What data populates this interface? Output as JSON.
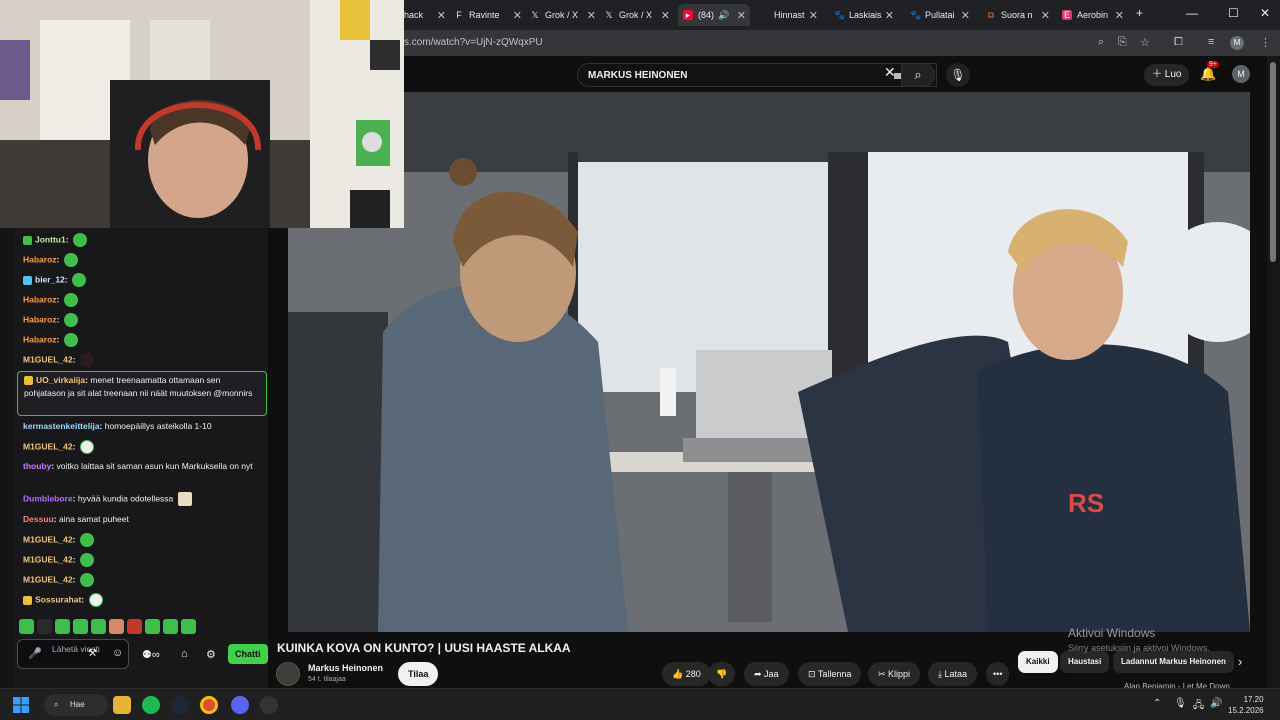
{
  "browser": {
    "tabs": [
      {
        "label": "hack",
        "favicon": "generic-icon"
      },
      {
        "label": "Ravinte",
        "favicon": "f-icon"
      },
      {
        "label": "Grok / X",
        "favicon": "x-icon"
      },
      {
        "label": "Grok / X",
        "favicon": "x-icon"
      },
      {
        "label": "(84)",
        "favicon": "youtube-icon",
        "active": true
      },
      {
        "label": "Hinnast",
        "favicon": "blank-icon"
      },
      {
        "label": "Laskiais",
        "favicon": "paw-icon"
      },
      {
        "label": "Pullatai",
        "favicon": "paw-icon"
      },
      {
        "label": "Suora n",
        "favicon": "link-icon"
      },
      {
        "label": "Aerobin",
        "favicon": "e-icon"
      }
    ],
    "url": "s.com/watch?v=UjN-zQWqxPU",
    "profile_initial": "M"
  },
  "youtube": {
    "search_query": "MARKUS HEINONEN",
    "create_label": "Luo",
    "notifications": "9+",
    "avatar_initial": "M",
    "video_title": "KUINKA KOVA ON KUNTO? | UUSI HAASTE ALKAA",
    "channel_name": "Markus Heinonen",
    "channel_subs": "54 t. tilaajaa",
    "subscribe_label": "Tilaa",
    "like_count": "280",
    "share_label": "Jaa",
    "save_label": "Tallenna",
    "clip_label": "Klippi",
    "download_label": "Lataa",
    "chips": [
      "Kaikki",
      "Haustasi",
      "Ladannut Markus Heinonen"
    ],
    "related_snippet": "Alan Benjamin - Let Me Down",
    "windows_activation_title": "Aktivoi Windows",
    "windows_activation_text": "Siirry asetuksiin ja aktivoi Windows."
  },
  "chat": {
    "messages": [
      {
        "user": "Jonttu1",
        "color": "#b6f0a0",
        "text": "",
        "emote": "green"
      },
      {
        "user": "Habaroz",
        "color": "#ff9e42",
        "text": "",
        "emote": "green"
      },
      {
        "user": "bier_12",
        "color": "#d0e4ff",
        "text": "",
        "emote": "green"
      },
      {
        "user": "Habaroz",
        "color": "#ff9e42",
        "text": "",
        "emote": "green"
      },
      {
        "user": "Habaroz",
        "color": "#ff9e42",
        "text": "",
        "emote": "green"
      },
      {
        "user": "Habaroz",
        "color": "#ff9e42",
        "text": "",
        "emote": "green"
      },
      {
        "user": "M1GUEL_42",
        "color": "#f0c674",
        "text": "",
        "emote": "dark"
      },
      {
        "user": "UO_virkaiija",
        "color": "#f0c674",
        "text": "menet treenaamatta ottamaan sen pohjatason ja sit alat treenaan nii näät muutoksen @monnirs",
        "emote": ""
      },
      {
        "user": "kermastenkeittelija",
        "color": "#9ad7ff",
        "text": "homoepäillys asteikolla 1-10",
        "emote": ""
      },
      {
        "user": "M1GUEL_42",
        "color": "#f0c674",
        "text": "",
        "emote": "white"
      },
      {
        "user": "thouby",
        "color": "#c77dff",
        "text": "voitko laittaa sit saman asun kun Markuksella on nyt",
        "emote": ""
      },
      {
        "user": "Dumblebore",
        "color": "#b86bff",
        "text": "hyvää kundia odotellessa",
        "emote": "tan"
      },
      {
        "user": "Dessuu",
        "color": "#ff7f7f",
        "text": "aina samat puheet",
        "emote": ""
      },
      {
        "user": "M1GUEL_42",
        "color": "#f0c674",
        "text": "",
        "emote": "green"
      },
      {
        "user": "M1GUEL_42",
        "color": "#f0c674",
        "text": "",
        "emote": "green"
      },
      {
        "user": "M1GUEL_42",
        "color": "#f0c674",
        "text": "",
        "emote": "green"
      },
      {
        "user": "Sossurahat",
        "color": "#f0c674",
        "text": "",
        "emote": "white"
      }
    ],
    "input_placeholder": "Lähetä viesti",
    "send_label": "Chatti"
  },
  "taskbar": {
    "search_label": "Hae",
    "time": "17.20",
    "date": "15.2.2026"
  },
  "colors": {
    "accent_green": "#41d049",
    "youtube_red": "#cc0000"
  }
}
